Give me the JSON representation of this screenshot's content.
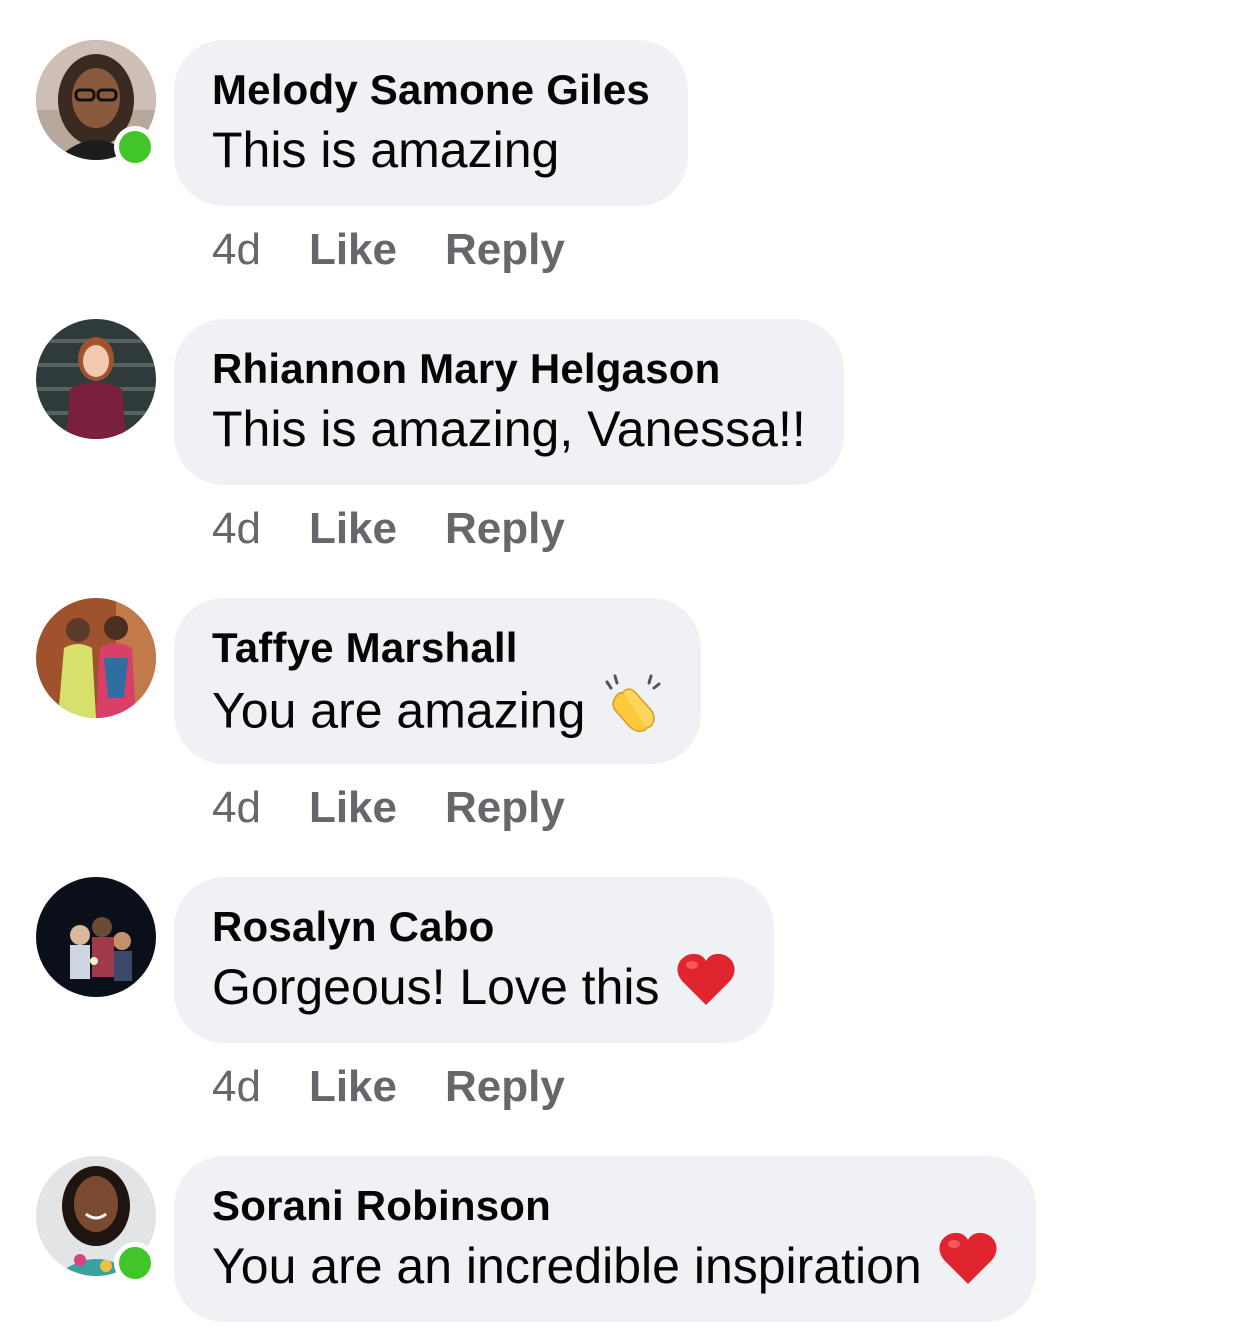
{
  "comments": [
    {
      "author": "Melody Samone Giles",
      "text": "This is amazing",
      "time": "4d",
      "like_label": "Like",
      "reply_label": "Reply",
      "online": true
    },
    {
      "author": "Rhiannon Mary Helgason",
      "text": "This is amazing, Vanessa!!",
      "time": "4d",
      "like_label": "Like",
      "reply_label": "Reply",
      "online": false
    },
    {
      "author": "Taffye Marshall",
      "text": "You are amazing",
      "emoji": "clapping-hands-icon",
      "time": "4d",
      "like_label": "Like",
      "reply_label": "Reply",
      "online": false
    },
    {
      "author": "Rosalyn Cabo",
      "text": "Gorgeous! Love this",
      "emoji": "red-heart-icon",
      "time": "4d",
      "like_label": "Like",
      "reply_label": "Reply",
      "online": false
    },
    {
      "author": "Sorani Robinson",
      "text": "You are an incredible inspiration",
      "emoji": "red-heart-icon",
      "online": true
    }
  ],
  "colors": {
    "bubble": "#f0f1f5",
    "meta_text": "#65676b",
    "online": "#42c52b",
    "heart": "#e0252f",
    "clap": "#ffc83d"
  }
}
